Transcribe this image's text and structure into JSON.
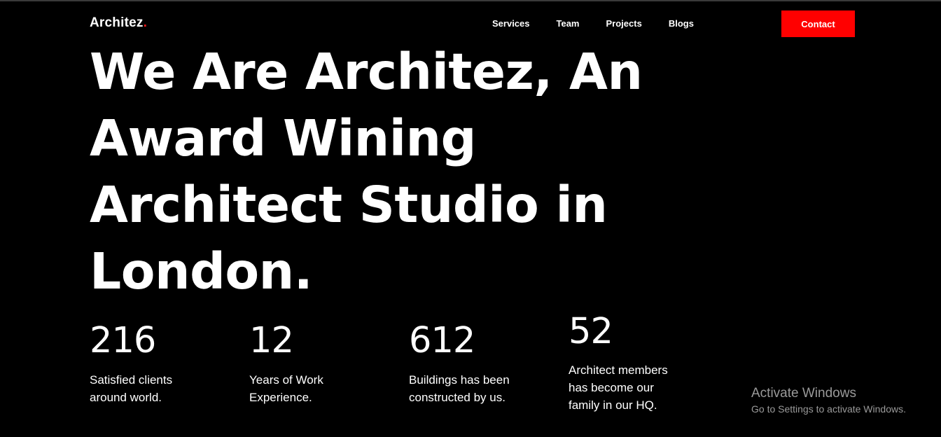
{
  "header": {
    "logo_text": "Architez",
    "logo_dot": ".",
    "nav": [
      {
        "label": "Services"
      },
      {
        "label": "Team"
      },
      {
        "label": "Projects"
      },
      {
        "label": "Blogs"
      }
    ],
    "contact_label": "Contact"
  },
  "hero": {
    "heading": "We Are Architez, An Award Wining Architect Studio in London."
  },
  "stats": [
    {
      "value": "216",
      "label": "Satisfied clients around world."
    },
    {
      "value": "12",
      "label": "Years of Work Experience."
    },
    {
      "value": "612",
      "label": "Buildings has been constructed by us."
    },
    {
      "value": "52",
      "label": "Architect members has become our family in our HQ."
    }
  ],
  "watermark": {
    "title": "Activate Windows",
    "subtitle": "Go to Settings to activate Windows."
  },
  "colors": {
    "background": "#000000",
    "text": "#ffffff",
    "accent": "#ff0000",
    "watermark": "#9a9a9a"
  }
}
